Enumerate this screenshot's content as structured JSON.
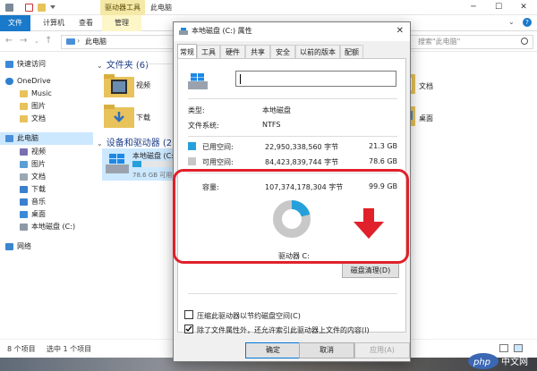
{
  "explorer": {
    "title": "此电脑",
    "ctx_tab": "驱动器工具",
    "ribbon_tabs": [
      "文件",
      "计算机",
      "查看",
      "管理"
    ],
    "address": "此电脑",
    "search_placeholder": "搜索\"此电脑\"",
    "nav": [
      {
        "label": "快速访问"
      },
      {
        "label": "OneDrive"
      },
      {
        "label": "Music"
      },
      {
        "label": "图片"
      },
      {
        "label": "文档"
      },
      {
        "label": "此电脑"
      },
      {
        "label": "视频"
      },
      {
        "label": "图片"
      },
      {
        "label": "文档"
      },
      {
        "label": "下载"
      },
      {
        "label": "音乐"
      },
      {
        "label": "桌面"
      },
      {
        "label": "本地磁盘 (C:)"
      },
      {
        "label": "网络"
      }
    ],
    "folders_header": "文件夹 (6)",
    "folders": [
      "视频",
      "下载",
      "文档",
      "桌面"
    ],
    "devices_header": "设备和驱动器 (2)",
    "drive": {
      "name": "本地磁盘 (C:",
      "free": "78.6 GB 可用",
      "used_fraction": 0.21
    },
    "status_items": "8 个项目",
    "status_selected": "选中 1 个项目"
  },
  "dialog": {
    "title": "本地磁盘 (C:) 属性",
    "close": "✕",
    "tabs": [
      "常规",
      "工具",
      "硬件",
      "共享",
      "安全",
      "以前的版本",
      "配额"
    ],
    "type_label": "类型:",
    "type_value": "本地磁盘",
    "fs_label": "文件系统:",
    "fs_value": "NTFS",
    "used_label": "已用空间:",
    "used_bytes": "22,950,338,560 字节",
    "used_gb": "21.3 GB",
    "free_label": "可用空间:",
    "free_bytes": "84,423,839,744 字节",
    "free_gb": "78.6 GB",
    "cap_label": "容量:",
    "cap_bytes": "107,374,178,304 字节",
    "cap_gb": "99.9 GB",
    "drive_label": "驱动器 C:",
    "cleanup_button": "磁盘清理(D)",
    "compress_label": "压缩此驱动器以节约磁盘空间(C)",
    "index_label": "除了文件属性外，还允许索引此驱动器上文件的内容(I)",
    "compress_checked": false,
    "index_checked": true,
    "ok": "确定",
    "cancel": "取消",
    "apply": "应用(A)",
    "used_fraction": 0.21,
    "used_color": "#26a0da",
    "free_color": "#c8c8c8"
  },
  "annotation": {
    "color": "#e0202a"
  },
  "watermark": "php 中文网"
}
